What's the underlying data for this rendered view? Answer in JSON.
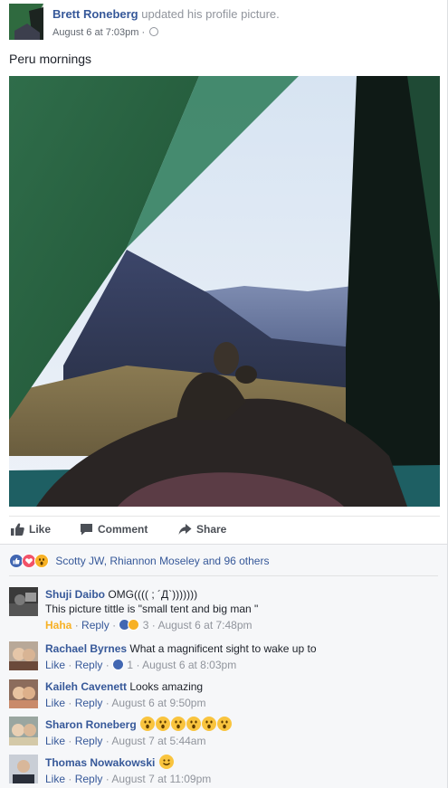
{
  "post": {
    "author": "Brett Roneberg",
    "action": "updated his profile picture.",
    "timestamp": "August 6 at 7:03pm",
    "separator": "·",
    "caption": "Peru mornings"
  },
  "actions": {
    "like": "Like",
    "comment": "Comment",
    "share": "Share"
  },
  "reactions": {
    "summary": "Scotty JW, Rhiannon Moseley and 96 others",
    "icons": [
      "like-icon",
      "love-icon",
      "wow-icon"
    ]
  },
  "comments": [
    {
      "name": "Shuji Daibo",
      "text": "OMG(((( ; ´Д`)))))))",
      "text2": "This picture tittle is \"small tent and big man \"",
      "reaction_label": "Haha",
      "reply": "Reply",
      "reaction_count": "3",
      "time": "August 6 at 7:48pm"
    },
    {
      "name": "Rachael Byrnes",
      "text": "What a magnificent sight to wake up to",
      "like": "Like",
      "reply": "Reply",
      "reaction_count": "1",
      "time": "August 6 at 8:03pm"
    },
    {
      "name": "Kaileh Cavenett",
      "text": "Looks amazing",
      "like": "Like",
      "reply": "Reply",
      "time": "August 6 at 9:50pm"
    },
    {
      "name": "Sharon Roneberg",
      "text": "",
      "like": "Like",
      "reply": "Reply",
      "time": "August 7 at 5:44am"
    },
    {
      "name": "Thomas Nowakowski",
      "text": "",
      "like": "Like",
      "reply": "Reply",
      "time": "August 7 at 11:09pm"
    }
  ],
  "colors": {
    "link": "#365899",
    "muted": "#90949c",
    "like_blue": "#4267b2",
    "haha_yellow": "#f7b125"
  }
}
